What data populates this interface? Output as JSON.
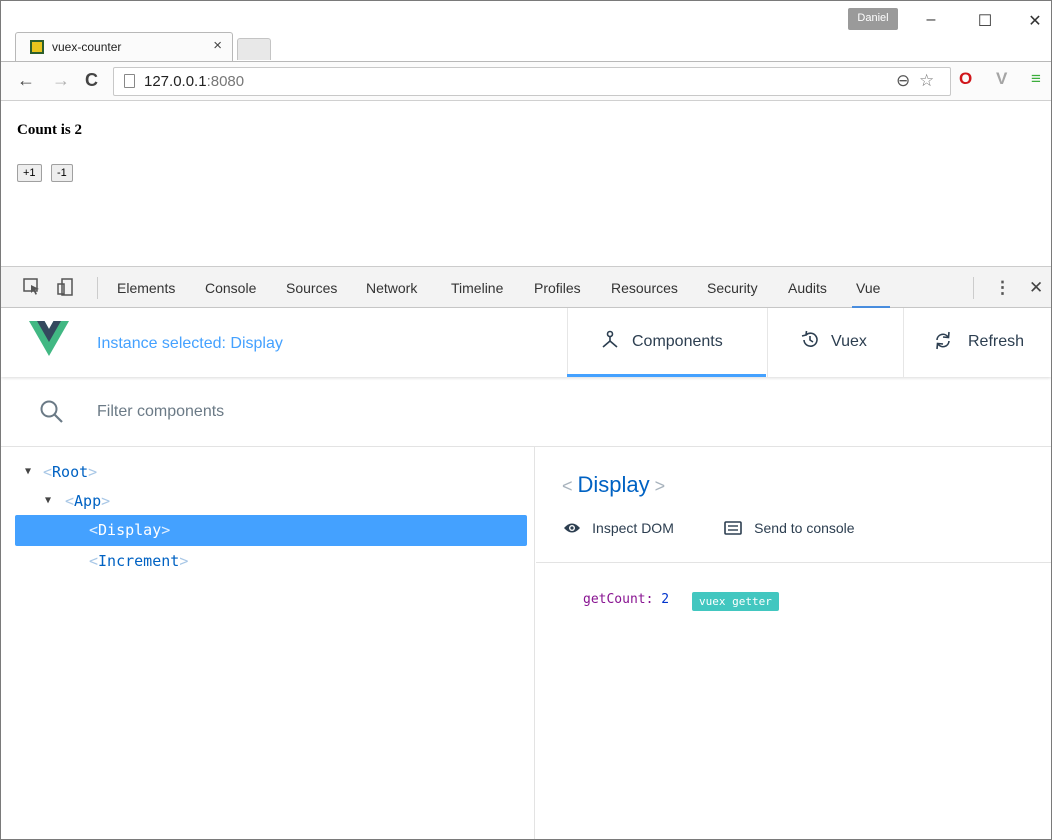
{
  "browser": {
    "tab_title": "vuex-counter",
    "tab_close": "×",
    "profile_name": "Daniel",
    "url_host": "127.0.0.1",
    "url_port": ":8080",
    "window_controls": {
      "minimize": "–",
      "maximize": "☐",
      "close": "✕"
    },
    "nav": {
      "back": "←",
      "forward": "→",
      "reload": "C"
    },
    "icons": {
      "zoom": "⊖",
      "star": "☆",
      "opera": "O",
      "vivaldi": "V",
      "menu": "≡"
    }
  },
  "page": {
    "count_text": "Count is 2",
    "increment_label": "+1",
    "decrement_label": "-1"
  },
  "devtools": {
    "tabs": [
      "Elements",
      "Console",
      "Sources",
      "Network",
      "Timeline",
      "Profiles",
      "Resources",
      "Security",
      "Audits",
      "Vue"
    ],
    "active_tab": "Vue",
    "more_icon": "⋮",
    "close_icon": "✕"
  },
  "vue": {
    "instance_selected": "Instance selected: Display",
    "header_buttons": {
      "components": "Components",
      "vuex": "Vuex",
      "refresh": "Refresh"
    },
    "filter_placeholder": "Filter components",
    "tree": {
      "root": "Root",
      "app": "App",
      "display": "Display",
      "increment": "Increment"
    },
    "inspector": {
      "title": "Display",
      "inspect_dom": "Inspect DOM",
      "send_to_console": "Send to console",
      "prop_key": "getCount:",
      "prop_value": "2",
      "badge": "vuex getter"
    },
    "colors": {
      "accent": "#44a1ff",
      "logo_green": "#41b883",
      "logo_dark": "#34495e",
      "badge": "#42c7c0"
    }
  }
}
